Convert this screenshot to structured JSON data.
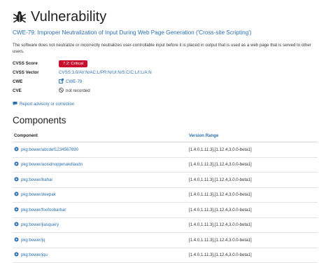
{
  "header": {
    "title": "Vulnerability",
    "subtitle": "CWE-79: Improper Neutralization of Input During Web Page Generation ('Cross-site Scripting')"
  },
  "description": "The software does not neutralize or incorrectly neutralizes user-controllable input before it is placed in output that is used as a web page that is served to other users.",
  "properties": {
    "cvss_score": {
      "label": "CVSS Score",
      "value": "7.2: Critical",
      "color": "#c8102e"
    },
    "cvss_vector": {
      "label": "CVSS Vector",
      "value": "CVSS:3.0/AV:N/AC:L/PR:N/UI:N/S:C/C:L/I:L/A:N"
    },
    "cwe": {
      "label": "CWE",
      "value": "CWE-79"
    },
    "cve": {
      "label": "CVE",
      "value": "not recorded"
    }
  },
  "report_link": "Report advisory or correction",
  "components": {
    "title": "Components",
    "headers": {
      "component": "Component",
      "version_range": "Version Range"
    },
    "rows": [
      {
        "name": "pkg:bower/abcdef1234567890",
        "range": "[1.4.0,1.11.3],[1.12.4,3.0.0-beta1]"
      },
      {
        "name": "pkg:bower/aoisdnopjwnakdlasdn",
        "range": "[1.4.0,1.11.3],[1.12.4,3.0.0-beta1]"
      },
      {
        "name": "pkg:bower/bahar",
        "range": "[1.4.0,1.11.3],[1.12.4,3.0.0-beta1]"
      },
      {
        "name": "pkg:bower/deepak",
        "range": "[1.4.0,1.11.3],[1.12.4,3.0.0-beta1]"
      },
      {
        "name": "pkg:bower/foofoobarbar",
        "range": "[1.4.0,1.11.3],[1.12.4,3.0.0-beta1]"
      },
      {
        "name": "pkg:bower/jiasquery",
        "range": "[1.4.0,1.11.3],[1.12.4,3.0.0-beta1]"
      },
      {
        "name": "pkg:bower/jq",
        "range": "[1.4.0,1.11.3],[1.12.4,3.0.0-beta1]"
      },
      {
        "name": "pkg:bower/jqu",
        "range": "[1.4.0,1.11.3],[1.12.4,3.0.0-beta1]"
      }
    ]
  },
  "icons": {
    "title": "bug-icon",
    "cwe": "external-link-icon",
    "cve": "block-icon",
    "report": "comment-icon",
    "component": "package-icon"
  },
  "colors": {
    "link": "#2a6fb0",
    "critical": "#c8102e"
  }
}
